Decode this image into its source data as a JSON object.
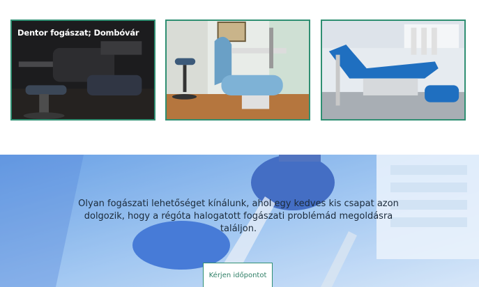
{
  "gallery": {
    "images": [
      {
        "caption": "Dentor fogászat; Dombóvár",
        "alt": "dental-chair-dark"
      },
      {
        "caption": "",
        "alt": "dental-office-blue-chair"
      },
      {
        "caption": "",
        "alt": "dental-chair-reclined"
      }
    ]
  },
  "hero": {
    "text": "Olyan fogászati lehetőséget kínálunk, ahol egy kedves kis csapat azon dolgozik, hogy a régóta halogatott fogászati problémád megoldásra találjon.",
    "cta_label": "Kérjen időpontot"
  },
  "colors": {
    "accent": "#2f8f72",
    "hero_tint": "#3b7fd8"
  }
}
